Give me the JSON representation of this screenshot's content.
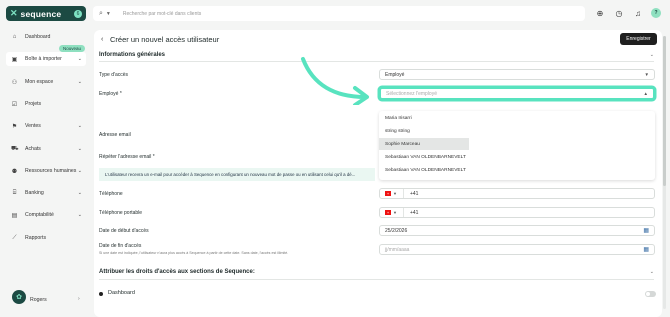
{
  "app": {
    "logo_text": "sequence",
    "logo_badge": "6"
  },
  "search": {
    "placeholder": "Recherche par mot-clé dans clients"
  },
  "topbar": {
    "avatar_initial": "?"
  },
  "sidebar": {
    "items": [
      {
        "label": "Dashboard",
        "icon": "home-icon"
      },
      {
        "label": "Boîte à importer",
        "icon": "inbox-icon",
        "badge": "Nouveau"
      },
      {
        "label": "Mon espace",
        "icon": "user-icon"
      },
      {
        "label": "Projets",
        "icon": "check-square-icon"
      },
      {
        "label": "Ventes",
        "icon": "tag-icon"
      },
      {
        "label": "Achats",
        "icon": "cart-icon"
      },
      {
        "label": "Ressources humaines",
        "icon": "people-icon"
      },
      {
        "label": "Banking",
        "icon": "bank-icon"
      },
      {
        "label": "Comptabilité",
        "icon": "ledger-icon"
      },
      {
        "label": "Rapports",
        "icon": "chart-icon"
      }
    ],
    "user": {
      "name": "Rogers",
      "avatar_badge": "1"
    }
  },
  "page": {
    "title": "Créer un nouvel accès utilisateur",
    "save_label": "Enregistrer",
    "section_general": "Informations générales",
    "type_acces_label": "Type d'accès",
    "type_acces_value": "Employé",
    "employe_label": "Employé *",
    "employe_placeholder": "Sélectionnez l'employé",
    "email_label": "Adresse email",
    "repeat_email_label": "Répéter l'adresse email *",
    "info_text": "L'utilisateur recevra un e-mail pour accéder à Sequence en configurant un nouveau mot de passe ou en utilisant celui qu'il a dé...",
    "telephone_label": "Téléphone",
    "telephone_prefix": "+41",
    "mobile_label": "Téléphone portable",
    "mobile_prefix": "+41",
    "start_label": "Date de début d'accès",
    "start_value": "25/2/2026",
    "end_label": "Date de fin d'accès",
    "end_sub": "Si une date est indiquée, l'utilisateur n'aura plus accès à Sequence à partir de cette date. Sans date, l'accès est illimité.",
    "end_placeholder": "jj/mm/aaaa",
    "section_rights": "Attribuer les droits d'accès aux sections de Sequence:",
    "rights_item": "Dashboard"
  },
  "dropdown": {
    "options": [
      "Maria Irisarri",
      "string string",
      "Sophie Marceau",
      "Sebastiaan VAN OLDENBARNEVELT",
      "Sebastiaan VAN OLDENBARNEVELT"
    ],
    "highlighted": 2
  },
  "colors": {
    "brand": "#1c4a43",
    "accent": "#58e3bf",
    "info_bg": "#eaf7f2"
  }
}
